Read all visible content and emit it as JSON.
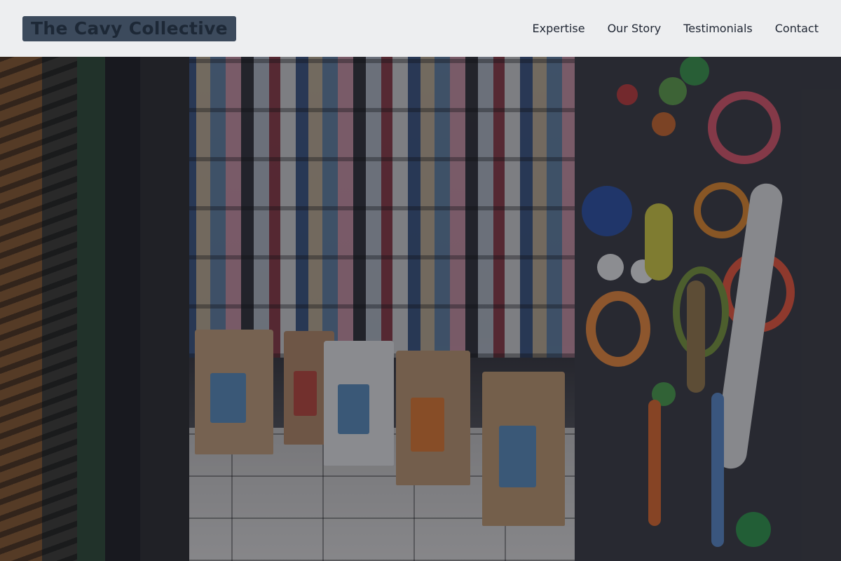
{
  "header": {
    "brand": "The Cavy Collective",
    "nav": [
      {
        "label": "Expertise"
      },
      {
        "label": "Our Story"
      },
      {
        "label": "Testimonials"
      },
      {
        "label": "Contact"
      }
    ]
  },
  "hero": {
    "image_subject": "pet shop interior with clothes, food bags and toys"
  },
  "colors": {
    "brand_bg": "#3c4a5c",
    "brand_text": "#1d2836",
    "nav_text": "#1f2633",
    "header_bg": "#f4f5f7"
  }
}
